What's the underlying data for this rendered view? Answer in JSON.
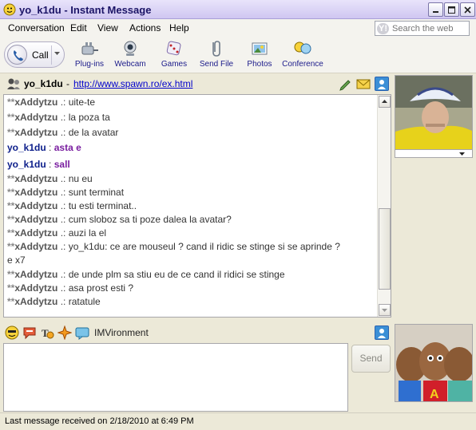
{
  "window": {
    "title": "yo_k1du - Instant Message",
    "controls": [
      "minimize",
      "maximize",
      "close"
    ]
  },
  "menu": {
    "items": [
      "Conversation",
      "Edit",
      "View",
      "Actions",
      "Help"
    ],
    "search_placeholder": "Search the web"
  },
  "toolbar": {
    "call_label": "Call",
    "tools": [
      {
        "label": "Plug-ins",
        "icon": "plugins-icon"
      },
      {
        "label": "Webcam",
        "icon": "webcam-icon"
      },
      {
        "label": "Games",
        "icon": "games-icon"
      },
      {
        "label": "Send File",
        "icon": "send-file-icon"
      },
      {
        "label": "Photos",
        "icon": "photos-icon"
      },
      {
        "label": "Conference",
        "icon": "conference-icon"
      }
    ]
  },
  "header": {
    "buddy": "yo_k1du",
    "separator": "-",
    "status_link": "http://www.spawn.ro/ex.html"
  },
  "conversation": {
    "messages": [
      {
        "from": "xAddytzu",
        "prefix": "**",
        "sep": ".:",
        "text": "uite-te",
        "me": false
      },
      {
        "from": "xAddytzu",
        "prefix": "**",
        "sep": ".:",
        "text": "la poza ta",
        "me": false
      },
      {
        "from": "xAddytzu",
        "prefix": "**",
        "sep": ".:",
        "text": "de la avatar",
        "me": false
      },
      {
        "from": "yo_k1du",
        "prefix": "",
        "sep": ":",
        "text": "asta  e",
        "me": true
      },
      {
        "from": "yo_k1du",
        "prefix": "",
        "sep": ":",
        "text": "sall",
        "me": true
      },
      {
        "from": "xAddytzu",
        "prefix": "**",
        "sep": ".:",
        "text": "nu eu",
        "me": false
      },
      {
        "from": "xAddytzu",
        "prefix": "**",
        "sep": ".:",
        "text": "sunt terminat",
        "me": false
      },
      {
        "from": "xAddytzu",
        "prefix": "**",
        "sep": ".:",
        "text": "tu esti terminat..",
        "me": false
      },
      {
        "from": "xAddytzu",
        "prefix": "**",
        "sep": ".:",
        "text": "cum sloboz sa ti poze dalea la avatar?",
        "me": false
      },
      {
        "from": "xAddytzu",
        "prefix": "**",
        "sep": ".:",
        "text": "auzi la el",
        "me": false
      },
      {
        "from": "xAddytzu",
        "prefix": "**",
        "sep": ".:",
        "text": "yo_k1du: ce are mouseul ? cand il ridic se stinge si se aprinde ?",
        "me": false
      },
      {
        "from": "",
        "prefix": "",
        "sep": "",
        "text": "e x7",
        "me": false
      },
      {
        "from": "xAddytzu",
        "prefix": "**",
        "sep": ".:",
        "text": "de unde plm sa stiu eu de ce cand il ridici se stinge",
        "me": false
      },
      {
        "from": "xAddytzu",
        "prefix": "**",
        "sep": ".:",
        "text": "asa prost esti ?",
        "me": false
      },
      {
        "from": "xAddytzu",
        "prefix": "**",
        "sep": ".:",
        "text": "ratatule",
        "me": false
      }
    ]
  },
  "compose": {
    "imvironment_label": "IMVironment",
    "send_label": "Send",
    "emote_icons": [
      "smiley-icon",
      "speech-icon",
      "text-style-icon",
      "sparkle-icon",
      "chat-icon"
    ]
  },
  "status": {
    "text": "Last message received on 2/18/2010 at 6:49 PM"
  }
}
